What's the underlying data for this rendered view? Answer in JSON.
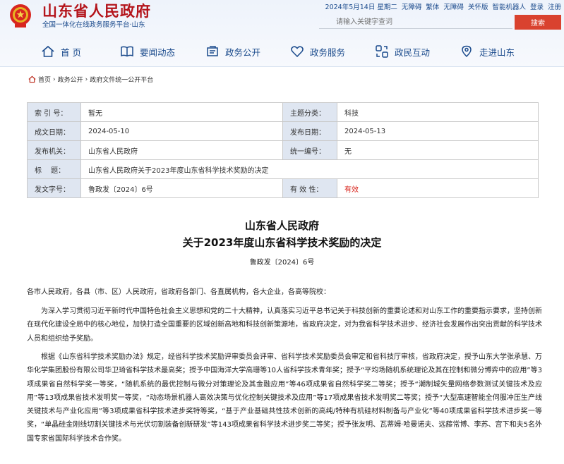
{
  "header": {
    "site_title": "山东省人民政府",
    "site_subtitle": "全国一体化在线政务服务平台·山东",
    "date": "2024年5月14日 星期二",
    "links": [
      "无障碍",
      "繁体",
      "无障碍",
      "关怀版",
      "智能机器人",
      "登录",
      "注册"
    ],
    "search_placeholder": "请输入关键字查词",
    "search_button": "搜索"
  },
  "nav": [
    "首 页",
    "要闻动态",
    "政务公开",
    "政务服务",
    "政民互动",
    "走进山东"
  ],
  "breadcrumb": [
    "首页",
    "政务公开",
    "政府文件统一公开平台"
  ],
  "meta": {
    "index_label": "索 引 号：",
    "index_value": "暂无",
    "topic_label": "主题分类：",
    "topic_value": "科技",
    "created_label": "成文日期：",
    "created_value": "2024-05-10",
    "published_label": "发布日期：",
    "published_value": "2024-05-13",
    "agency_label": "发布机关：",
    "agency_value": "山东省人民政府",
    "unified_label": "统一编号：",
    "unified_value": "无",
    "title_label": "标　 题：",
    "title_value": "山东省人民政府关于2023年度山东省科学技术奖励的决定",
    "docno_label": "发文字号：",
    "docno_value": "鲁政发〔2024〕6号",
    "validity_label": "有 效 性：",
    "validity_value": "有效"
  },
  "article": {
    "title_line1": "山东省人民政府",
    "title_line2": "关于2023年度山东省科学技术奖励的决定",
    "doc_number": "鲁政发〔2024〕6号",
    "salutation": "各市人民政府，各县（市、区）人民政府，省政府各部门、各直属机构，各大企业，各高等院校：",
    "paragraph1": "为深入学习贯彻习近平新时代中国特色社会主义思想和党的二十大精神，认真落实习近平总书记关于科技创新的重要论述和对山东工作的重要指示要求，坚持创新在现代化建设全局中的核心地位，加快打造全国重要的区域创新高地和科技创新策源地，省政府决定，对为我省科学技术进步、经济社会发展作出突出贡献的科学技术人员和组织给予奖励。",
    "paragraph2": "根据《山东省科学技术奖励办法》规定，经省科学技术奖励评审委员会评审、省科学技术奖励委员会审定和省科技厅审核，省政府决定，授予山东大学张承慧、万华化学集团股份有限公司华卫琦省科学技术最高奖；授予中国海洋大学高珊等10人省科学技术青年奖；授予“平均场随机系统理论及其在控制和微分博弈中的应用”等3项成果省自然科学奖一等奖，“随机系统的最优控制与微分对策理论及其金融应用”等46项成果省自然科学奖二等奖；授予“潮制城矢量网络参数测试关键技术及应用”等13项成果省技术发明奖一等奖，“动态场景机器人高效决策与优化控制关键技术及应用”等17项成果省技术发明奖二等奖；授予“大型高速智能全伺服冲压生产线关键技术与产业化应用”等3项成果省科学技术进步奖特等奖，“基于产业基础共性技术创新的高纯/特种有机硅材料制备与产业化”等40项成果省科学技术进步奖一等奖，“单晶硅金刚线切割关键技术与光伏切割装备创新研发”等143项成果省科学技术进步奖二等奖；授予张友明、瓦蒂姆·哈曼诺夫、远藤常博、李苏、宫下和夫5名外国专家省国际科学技术合作奖。"
  }
}
